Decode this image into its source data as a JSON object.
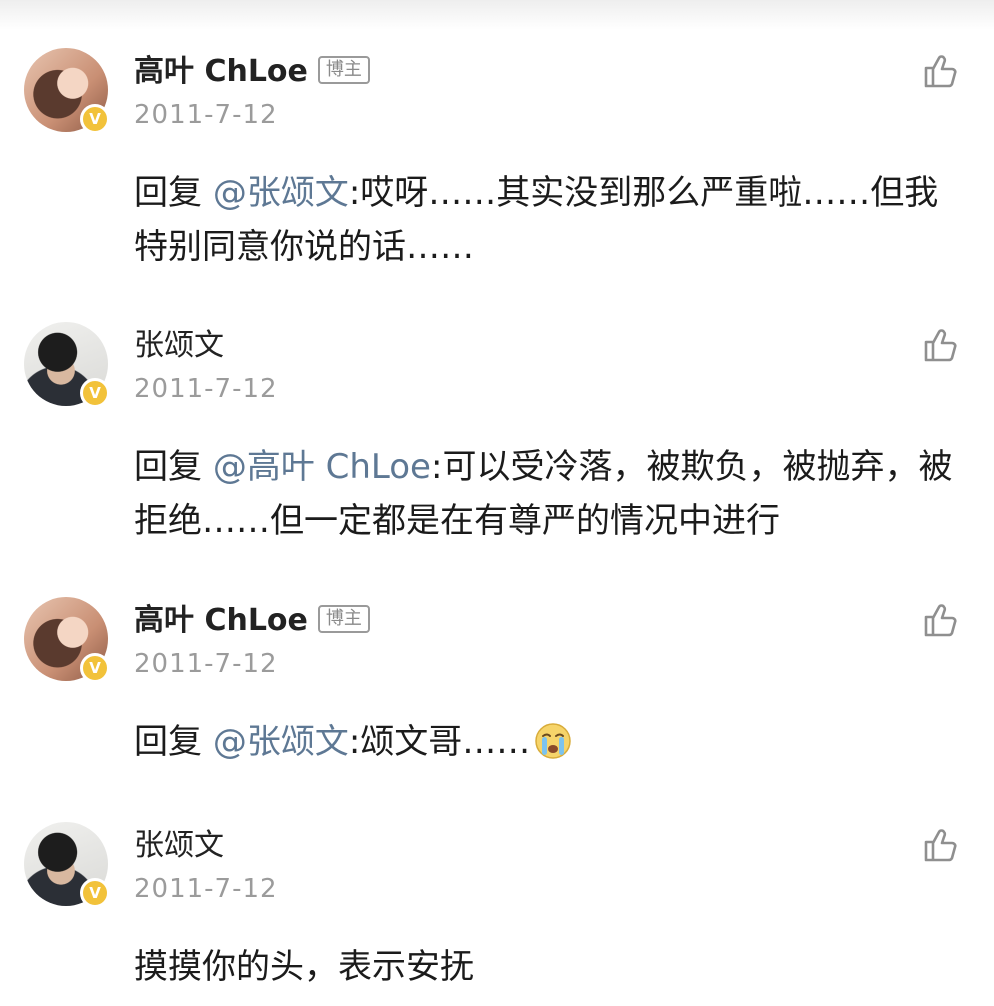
{
  "comments": [
    {
      "username": "高叶 ChLoe",
      "tag": "博主",
      "date": "2011-7-12",
      "reply_prefix": "回复 ",
      "mention": "@张颂文",
      "text": ":哎呀……其实没到那么严重啦……但我特别同意你说的话……",
      "avatar": "female-avatar",
      "verified_icon": "v-badge-icon",
      "like_icon": "thumbs-up-icon"
    },
    {
      "username": "张颂文",
      "date": "2011-7-12",
      "reply_prefix": "回复 ",
      "mention": "@高叶 ChLoe",
      "text": ":可以受冷落，被欺负，被抛弃，被拒绝……但一定都是在有尊严的情况中进行",
      "avatar": "male-avatar",
      "verified_icon": "v-badge-icon",
      "like_icon": "thumbs-up-icon"
    },
    {
      "username": "高叶 ChLoe",
      "tag": "博主",
      "date": "2011-7-12",
      "reply_prefix": "回复 ",
      "mention": "@张颂文",
      "text": ":颂文哥……",
      "emoji": "crying-face-emoji",
      "avatar": "female-avatar",
      "verified_icon": "v-badge-icon",
      "like_icon": "thumbs-up-icon"
    },
    {
      "username": "张颂文",
      "date": "2011-7-12",
      "text": "摸摸你的头，表示安抚",
      "avatar": "male-avatar",
      "verified_icon": "v-badge-icon",
      "like_icon": "thumbs-up-icon"
    }
  ],
  "colors": {
    "mention": "#5e7894",
    "timestamp": "#9b9b9b",
    "verified_badge": "#f2c23a"
  }
}
